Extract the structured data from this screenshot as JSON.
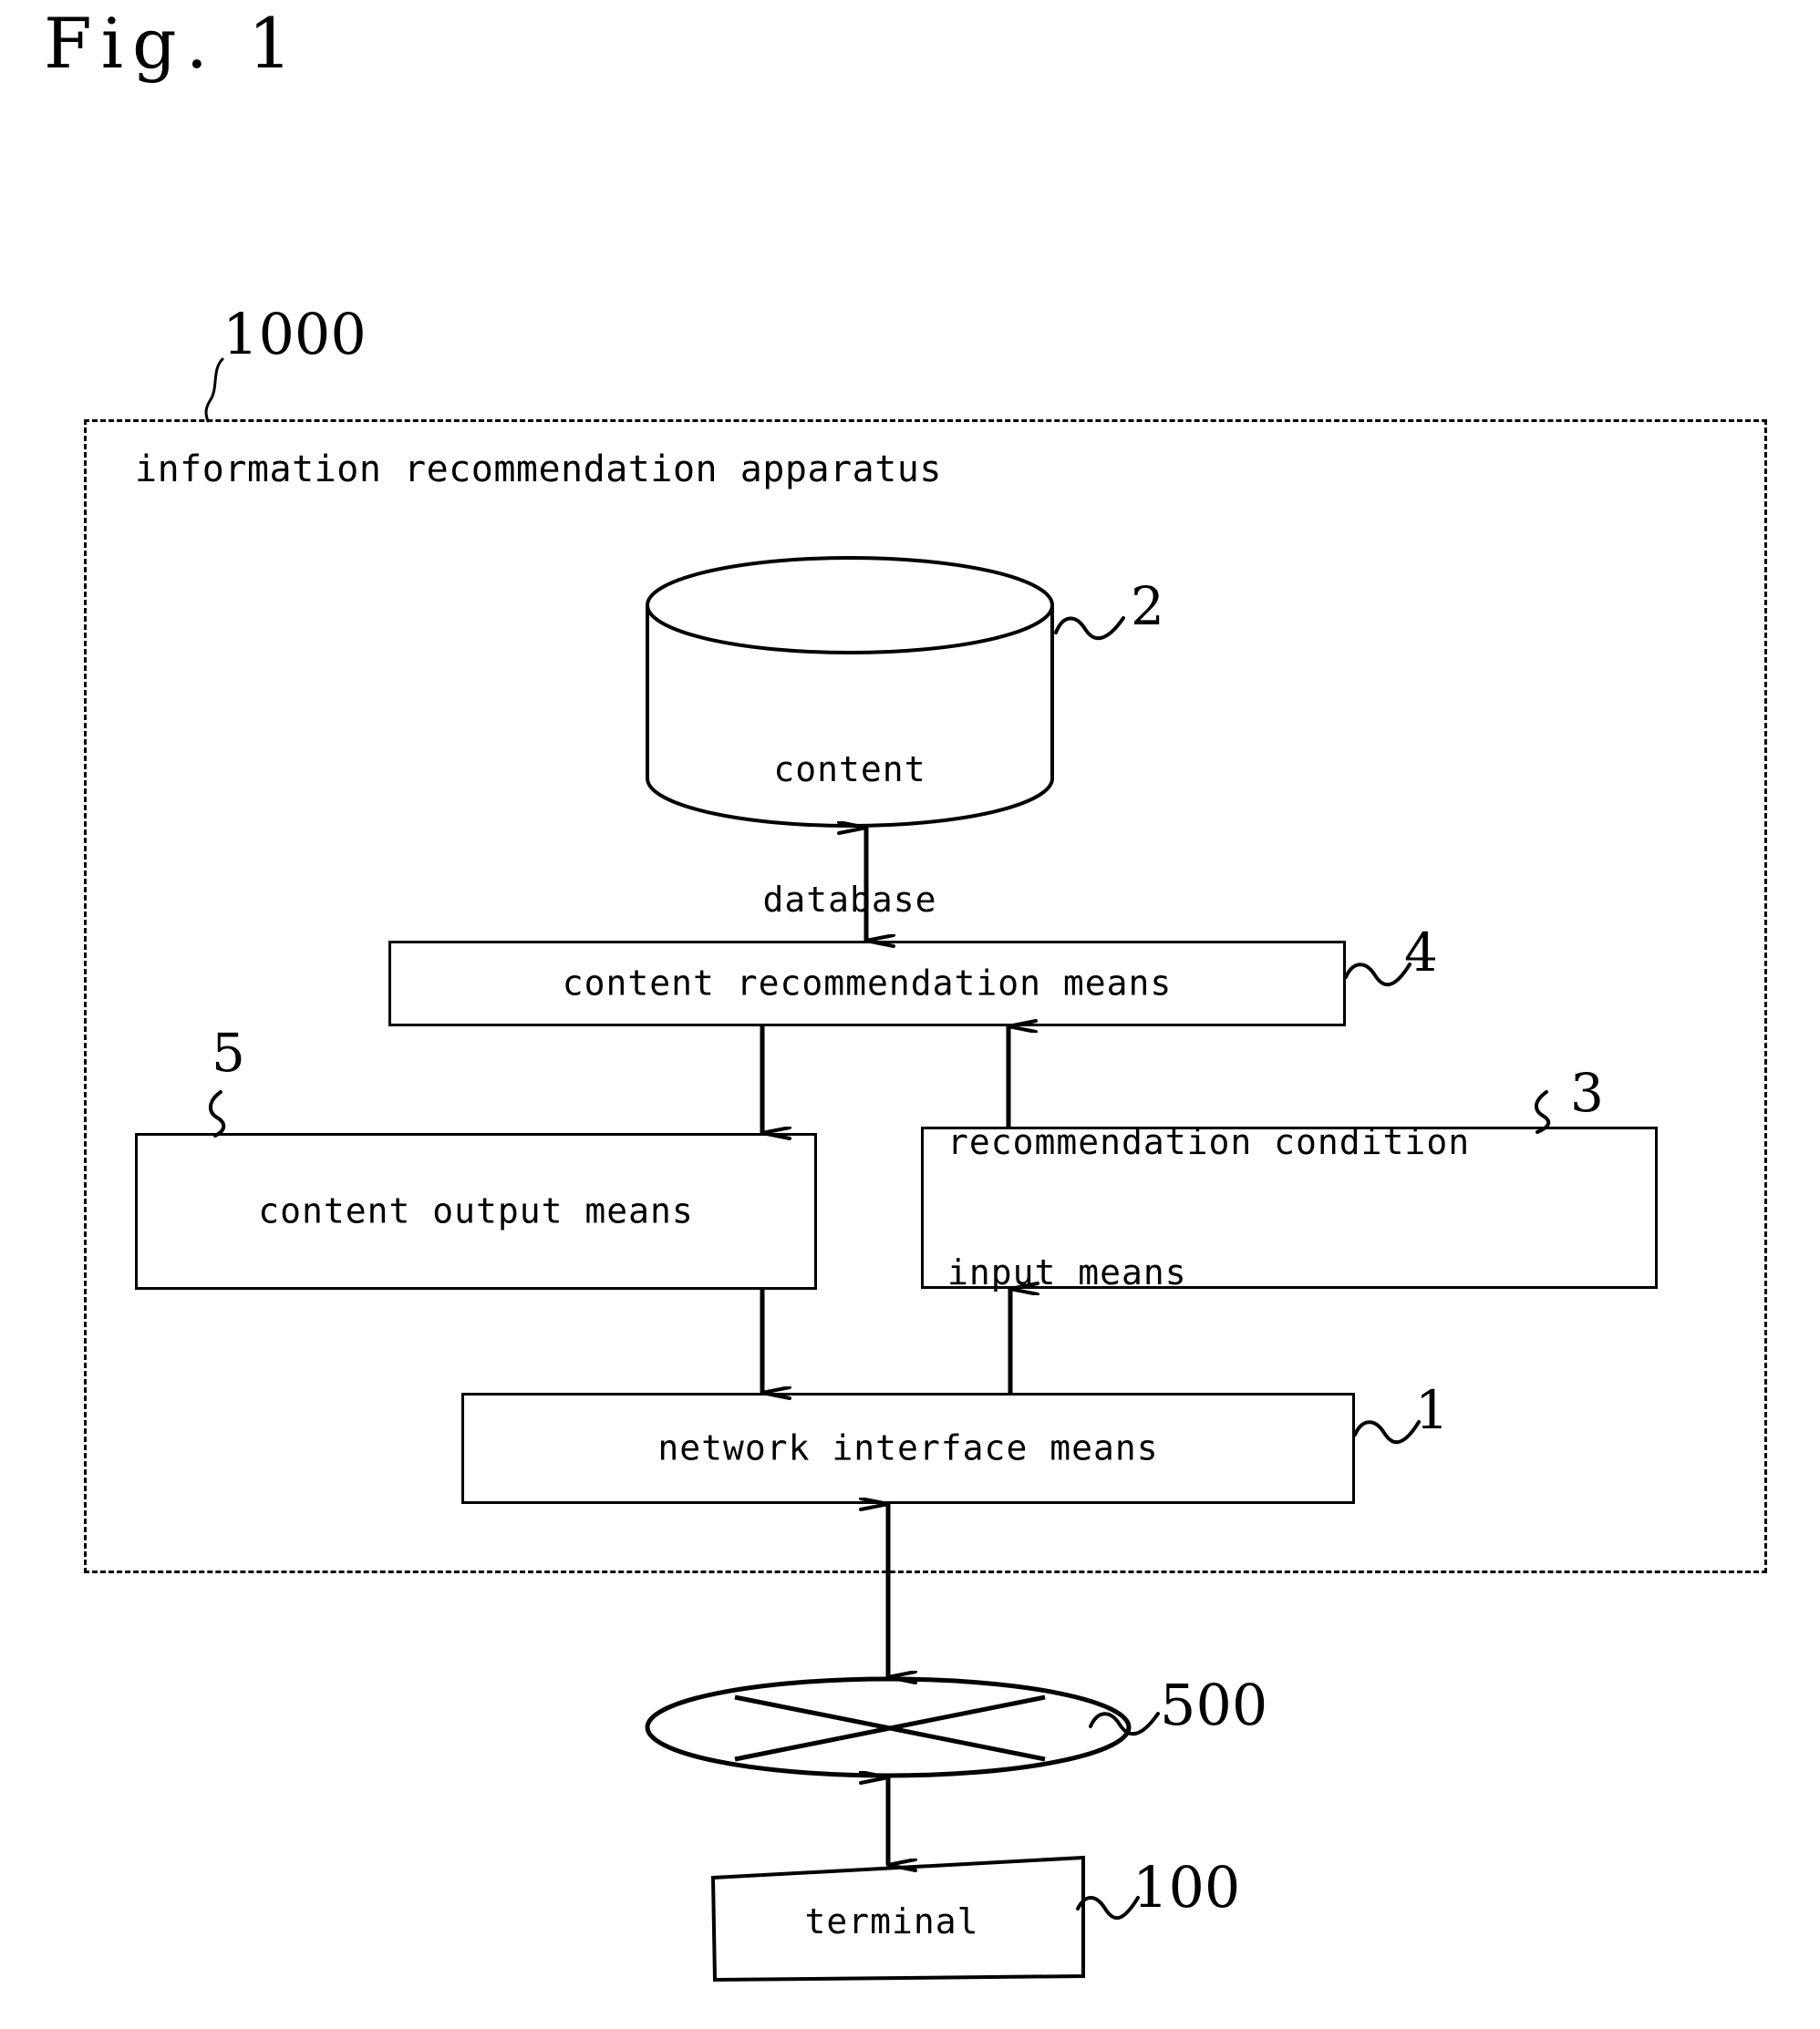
{
  "figure": {
    "title": "Fig. 1"
  },
  "apparatus": {
    "ref": "1000",
    "title": "information recommendation apparatus"
  },
  "nodes": {
    "content_database": {
      "ref": "2",
      "line1": "content",
      "line2": "database",
      "shape": "cylinder"
    },
    "content_recommendation_means": {
      "ref": "4",
      "label": "content recommendation means",
      "shape": "rectangle"
    },
    "content_output_means": {
      "ref": "5",
      "label": "content output means",
      "shape": "rectangle"
    },
    "recommendation_condition_input_means": {
      "ref": "3",
      "line1": "recommendation condition",
      "line2": "input means",
      "shape": "rectangle"
    },
    "network_interface_means": {
      "ref": "1",
      "label": "network interface means",
      "shape": "rectangle"
    },
    "network": {
      "ref": "500",
      "label": "",
      "shape": "ellipse-with-cross"
    },
    "terminal": {
      "ref": "100",
      "label": "terminal",
      "shape": "skewed-rectangle"
    }
  },
  "connections": [
    {
      "from": "content_database",
      "to": "content_recommendation_means",
      "arrow": "double"
    },
    {
      "from": "content_recommendation_means",
      "to": "content_output_means",
      "arrow": "single-down"
    },
    {
      "from": "recommendation_condition_input_means",
      "to": "content_recommendation_means",
      "arrow": "single-up"
    },
    {
      "from": "content_output_means",
      "to": "network_interface_means",
      "arrow": "single-down"
    },
    {
      "from": "network_interface_means",
      "to": "recommendation_condition_input_means",
      "arrow": "single-up"
    },
    {
      "from": "network_interface_means",
      "to": "network",
      "arrow": "double"
    },
    {
      "from": "network",
      "to": "terminal",
      "arrow": "double"
    }
  ],
  "colors": {
    "ink": "#000000",
    "paper": "#ffffff"
  }
}
